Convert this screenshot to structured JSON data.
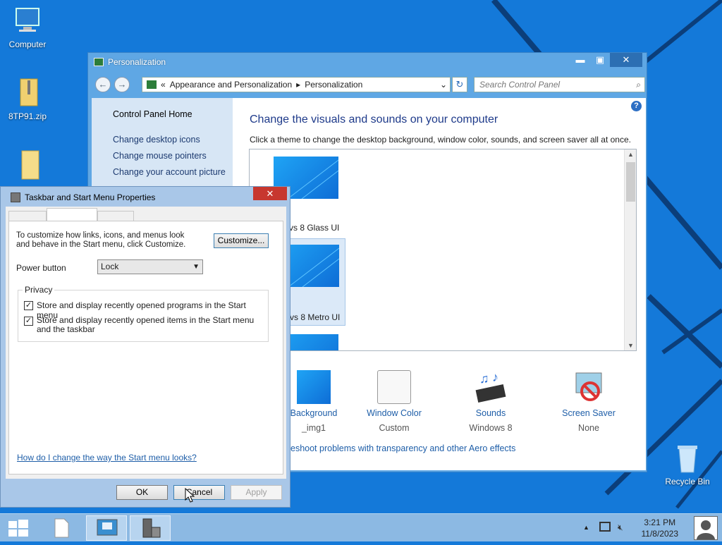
{
  "desktop": {
    "icons": [
      {
        "label": "Computer"
      },
      {
        "label": "8TP91.zip"
      },
      {
        "label": ""
      },
      {
        "label": "Recycle Bin"
      }
    ]
  },
  "personalization": {
    "title": "Personalization",
    "window_buttons": {
      "minimize": "▬",
      "maximize": "▣",
      "close": "✕"
    },
    "breadcrumb": {
      "separator": "«",
      "parts": [
        "Appearance and Personalization",
        "Personalization"
      ]
    },
    "search_placeholder": "Search Control Panel",
    "sidebar": {
      "home": "Control Panel Home",
      "links": [
        "Change desktop icons",
        "Change mouse pointers",
        "Change your account picture"
      ]
    },
    "heading": "Change the visuals and sounds on your computer",
    "subheading": "Click a theme to change the desktop background, window color, sounds, and screen saver all at once.",
    "themes": [
      {
        "label": "vs 8 Glass UI"
      },
      {
        "label": "vs 8 Metro UI"
      }
    ],
    "options": [
      {
        "name": "Background",
        "value": "_img1"
      },
      {
        "name": "Window Color",
        "value": "Custom"
      },
      {
        "name": "Sounds",
        "value": "Windows 8"
      },
      {
        "name": "Screen Saver",
        "value": "None"
      }
    ],
    "aero_link": "eshoot problems with transparency and other Aero effects"
  },
  "dialog": {
    "title": "Taskbar and Start Menu Properties",
    "close": "✕",
    "description": "To customize how links, icons, and menus look and behave in the Start menu, click Customize.",
    "customize_label": "Customize...",
    "power_button_label": "Power button",
    "power_button_value": "Lock",
    "privacy_title": "Privacy",
    "checkboxes": [
      {
        "label": "Store and display recently opened programs in the Start menu",
        "checked": true
      },
      {
        "label": "Store and display recently opened items in the Start menu and the taskbar",
        "checked": true
      }
    ],
    "help_link": "How do I change the way the Start menu looks?",
    "ok_label": "OK",
    "cancel_label": "Cancel",
    "apply_label": "Apply"
  },
  "taskbar": {
    "time": "3:21 PM",
    "date": "11/8/2023",
    "tray_caret": "▲"
  }
}
